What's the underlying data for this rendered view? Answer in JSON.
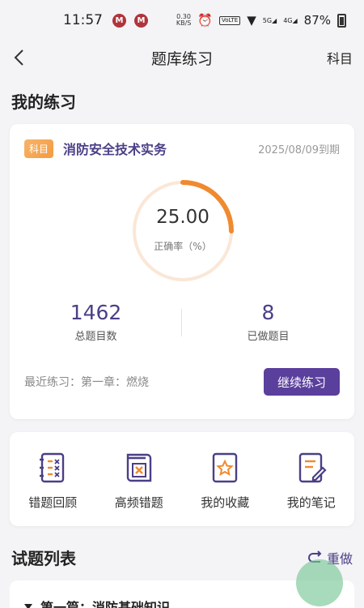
{
  "status_bar": {
    "time": "11:57",
    "app_icon_text": "M",
    "net_speed_value": "0.30",
    "net_speed_unit": "KB/S",
    "lte_label": "VoLTE",
    "signal_label_1": "5G",
    "signal_label_2": "4G",
    "battery_percent": "87%"
  },
  "nav": {
    "title": "题库练习",
    "right_label": "科目"
  },
  "my_practice": {
    "section_title": "我的练习",
    "tag": "科目",
    "subject": "消防安全技术实务",
    "due": "2025/08/09到期",
    "accuracy_value": "25.00",
    "accuracy_fraction": 0.25,
    "accuracy_label": "正确率（%）",
    "total_value": "1462",
    "total_label": "总题目数",
    "done_value": "8",
    "done_label": "已做题目",
    "recent": "最近练习：第一章：燃烧",
    "continue_label": "继续练习",
    "accent_color": "#f08a2e",
    "brand_color": "#5a3f9c"
  },
  "tools": [
    {
      "label": "错题回顾",
      "icon": "wrong-review-icon"
    },
    {
      "label": "高频错题",
      "icon": "frequent-wrong-icon"
    },
    {
      "label": "我的收藏",
      "icon": "favorites-icon"
    },
    {
      "label": "我的笔记",
      "icon": "notes-icon"
    }
  ],
  "question_list": {
    "title": "试题列表",
    "redo_label": "重做",
    "first_chapter": "第一篇：消防基础知识"
  }
}
